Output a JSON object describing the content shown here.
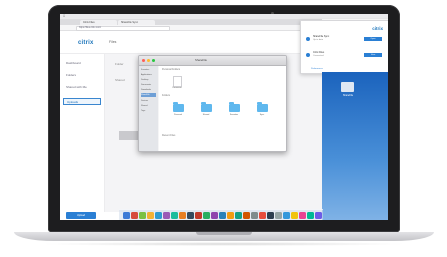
{
  "browser": {
    "tabs": [
      "Citrix Files",
      "ShareFile Sync"
    ],
    "address": "https://files.citrix.com/"
  },
  "app": {
    "logo": "citrix",
    "title": "Files",
    "nav": [
      "Dashboard",
      "Folders",
      "Shared with Me",
      "Uploads"
    ],
    "active_nav_index": 3,
    "upload_button": "Upload",
    "content_lines": [
      "Folder",
      "Shared"
    ]
  },
  "finder": {
    "title": "ShareFile",
    "sidebar_items": [
      "Favorites",
      "Applications",
      "Desktop",
      "Documents",
      "Downloads",
      "ShareFile",
      "Devices",
      "Shared",
      "Tags"
    ],
    "selected_sidebar_index": 5,
    "section_top": "Personal Folders",
    "file_name": "Document",
    "section_folders": "Folders",
    "folders": [
      "Personal",
      "Shared",
      "Favorites",
      "Sync"
    ],
    "footer": "Recent Files"
  },
  "notification": {
    "logo": "citrix",
    "items": [
      {
        "title": "ShareFile Sync",
        "sub": "Up to date",
        "button": "Open"
      },
      {
        "title": "Citrix Files",
        "sub": "Connected",
        "button": "View"
      }
    ],
    "footer": "Preferences"
  },
  "desktop": {
    "icon_label": "ShareFile"
  },
  "dock": {
    "colors": [
      "#3d7bd6",
      "#d64a3d",
      "#7bc043",
      "#f2b134",
      "#2e9ad0",
      "#9b59b6",
      "#1abc9c",
      "#e67e22",
      "#34495e",
      "#c0392b",
      "#27ae60",
      "#8e44ad",
      "#2980b9",
      "#f39c12",
      "#16a085",
      "#d35400",
      "#7f8c8d",
      "#e74c3c",
      "#2c3e50",
      "#95a5a6",
      "#3498db",
      "#f1c40f",
      "#e84393",
      "#00b894",
      "#6c5ce7"
    ]
  }
}
